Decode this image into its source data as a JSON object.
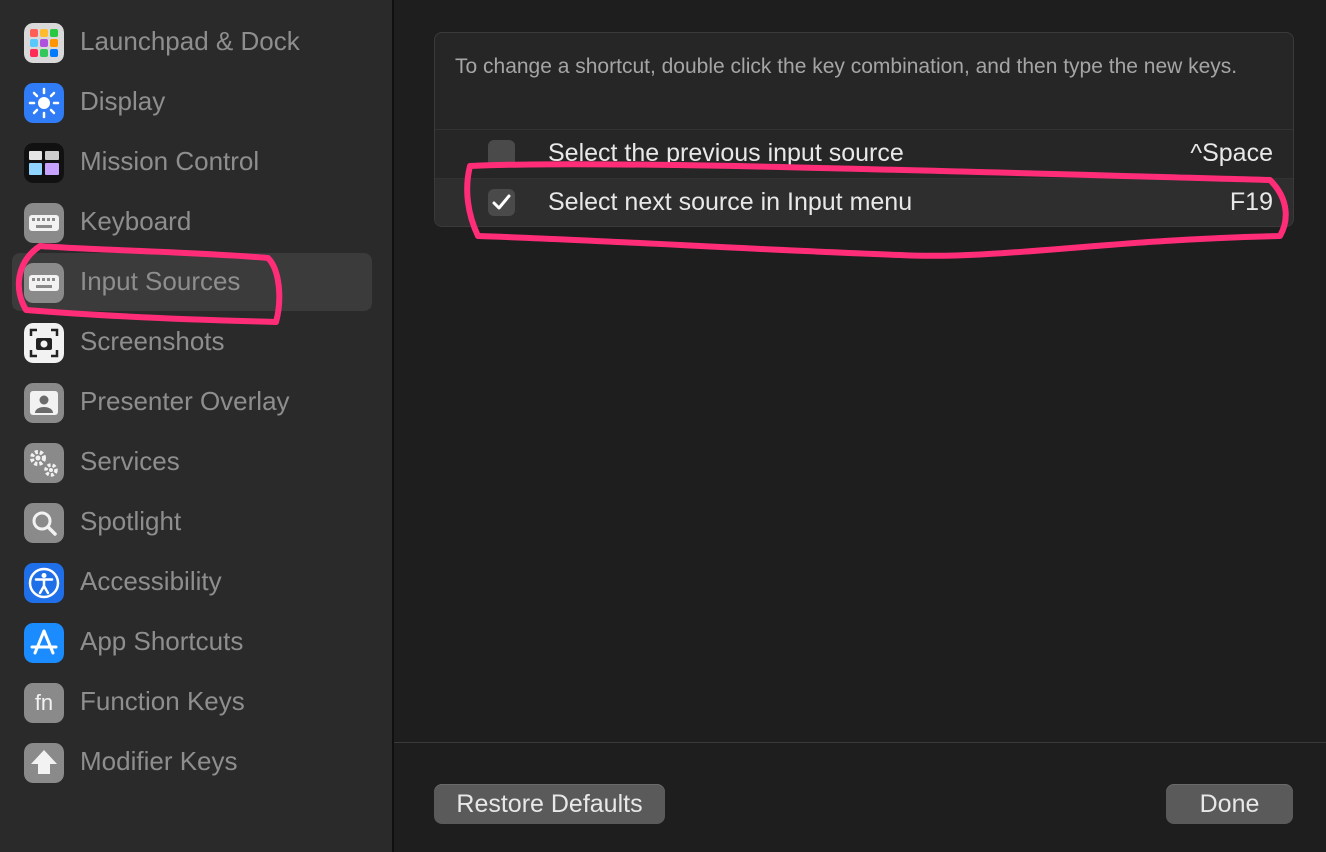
{
  "sidebar": {
    "items": [
      {
        "label": "Launchpad & Dock",
        "icon": "launchpad-icon"
      },
      {
        "label": "Display",
        "icon": "display-icon"
      },
      {
        "label": "Mission Control",
        "icon": "mission-control-icon"
      },
      {
        "label": "Keyboard",
        "icon": "keyboard-icon"
      },
      {
        "label": "Input Sources",
        "icon": "input-sources-icon",
        "selected": true
      },
      {
        "label": "Screenshots",
        "icon": "screenshot-icon"
      },
      {
        "label": "Presenter Overlay",
        "icon": "presenter-overlay-icon"
      },
      {
        "label": "Services",
        "icon": "gears-icon"
      },
      {
        "label": "Spotlight",
        "icon": "magnifier-icon"
      },
      {
        "label": "Accessibility",
        "icon": "accessibility-icon"
      },
      {
        "label": "App Shortcuts",
        "icon": "app-store-icon"
      },
      {
        "label": "Function Keys",
        "icon": "fn-icon"
      },
      {
        "label": "Modifier Keys",
        "icon": "up-arrow-icon"
      }
    ]
  },
  "main": {
    "instructions": "To change a shortcut, double click the key combination, and then type the new keys.",
    "fn_glyph": "fn",
    "shortcuts": [
      {
        "label": "Select the previous input source",
        "key": "^Space",
        "checked": false
      },
      {
        "label": "Select next source in Input menu",
        "key": "F19",
        "checked": true
      }
    ],
    "restore_label": "Restore Defaults",
    "done_label": "Done"
  },
  "colors": {
    "annotation": "#ff2d78",
    "sidebar_bg": "#2a2a2a",
    "main_bg": "#1e1e1e",
    "selected_bg": "#3b3b3b"
  }
}
